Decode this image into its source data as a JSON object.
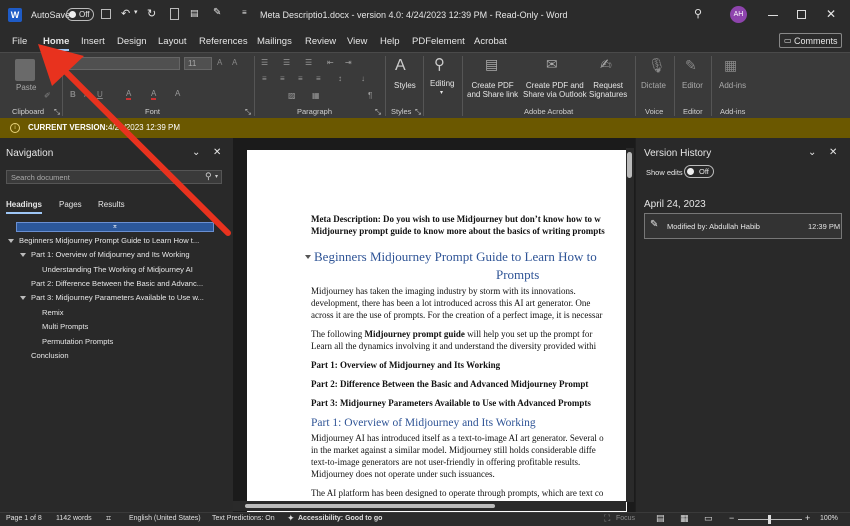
{
  "titlebar": {
    "autosave_label": "AutoSave",
    "autosave_state": "Off",
    "doc_title": "Meta Descriptio1.docx  -  version 4.0: 4/24/2023 12:39 PM  -  Read-Only  -  Word",
    "avatar_initials": "AH"
  },
  "menu": {
    "file": "File",
    "home": "Home",
    "insert": "Insert",
    "design": "Design",
    "layout": "Layout",
    "references": "References",
    "mailings": "Mailings",
    "review": "Review",
    "view": "View",
    "help": "Help",
    "pdfelement": "PDFelement",
    "acrobat": "Acrobat",
    "comments": "Comments"
  },
  "ribbon": {
    "paste": "Paste",
    "font_size": "11",
    "clipboard": "Clipboard",
    "font": "Font",
    "paragraph": "Paragraph",
    "styles_label": "Styles",
    "styles_group": "Styles",
    "editing": "Editing",
    "create_pdf": "Create PDF\nand Share link",
    "create_pdf_outlook": "Create PDF and\nShare via Outlook",
    "request_sig": "Request\nSignatures",
    "adobe_acrobat": "Adobe Acrobat",
    "dictate": "Dictate",
    "voice": "Voice",
    "editor": "Editor",
    "editor_group": "Editor",
    "addin": "Add-ins",
    "addins_group": "Add-ins"
  },
  "banner": {
    "label": "CURRENT VERSION:",
    "value": "4/24/2023 12:39 PM"
  },
  "nav": {
    "title": "Navigation",
    "search_placeholder": "Search document",
    "tabs": [
      "Headings",
      "Pages",
      "Results"
    ],
    "items": [
      "Beginners Midjourney Prompt Guide to Learn How t...",
      "Part 1: Overview of Midjourney and Its Working",
      "Understanding The Working of Midjourney AI",
      "Part 2: Difference Between the Basic and Advanc...",
      "Part 3: Midjourney Parameters Available to Use w...",
      "Remix",
      "Multi Prompts",
      "Permutation Prompts",
      "Conclusion"
    ]
  },
  "doc": {
    "meta1a": "Meta Description: ",
    "meta1b": "Do you wish to use Midjourney but don’t know how to w",
    "meta2": "Midjourney prompt guide to know more about the basics of writing prompts",
    "h1a": "Beginners Midjourney Prompt Guide to Learn How to",
    "h1b": "Prompts",
    "p1": "Midjourney has taken the imaging industry by storm with its innovations.",
    "p2": "development, there has been a lot introduced across this AI art generator. One",
    "p3": "across it are the use of prompts. For the creation of a perfect image, it is necessar",
    "p4a": "The following ",
    "p4b": "Midjourney prompt guide",
    "p4c": " will help you set up the prompt for",
    "p5": "Learn all the dynamics involving it and understand the diversity provided withi",
    "t1": "Part 1: Overview of Midjourney and Its Working",
    "t2": "Part 2: Difference Between the Basic and Advanced Midjourney Prompt",
    "t3": "Part 3: Midjourney Parameters Available to Use with Advanced Prompts",
    "h2": "Part 1: Overview of Midjourney and Its Working",
    "q1": "Midjourney AI has introduced itself as a text-to-image AI art generator. Several o",
    "q2": "in the market against a similar model. Midjourney still holds considerable diffe",
    "q3": "text-to-image generators are not user-friendly in offering profitable results.",
    "q4": "Midjourney does not operate under such issuances.",
    "q5": "The AI platform has been designed to operate through prompts, which are text co"
  },
  "vh": {
    "title": "Version History",
    "show_edits": "Show edits",
    "toggle": "Off",
    "date": "April 24, 2023",
    "modified": "Modified by: Abdullah Habib",
    "time": "12:39 PM"
  },
  "status": {
    "page": "Page 1 of 8",
    "words": "1142 words",
    "lang": "English (United States)",
    "predictions": "Text Predictions: On",
    "accessibility": "Accessibility: Good to go",
    "focus": "Focus",
    "zoom": "100%"
  },
  "colors": {
    "accent": "#e8321e",
    "banner": "#6b5800",
    "heading": "#2f5496"
  }
}
